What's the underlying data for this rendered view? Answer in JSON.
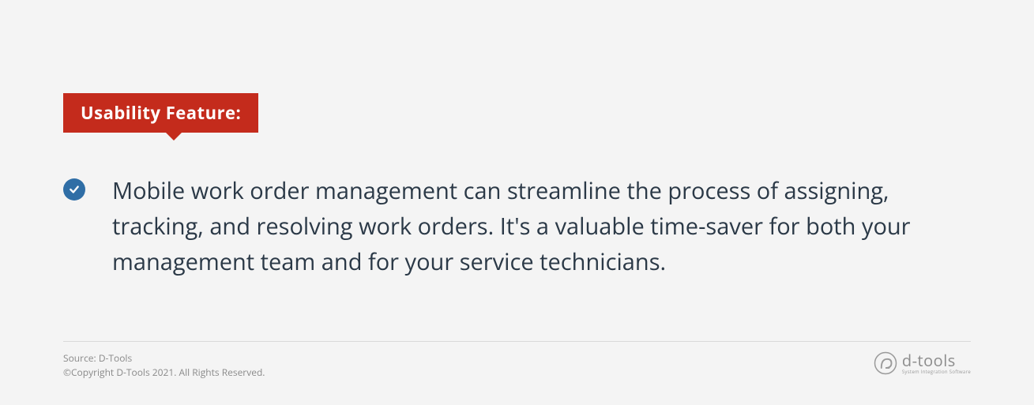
{
  "badge": {
    "label": "Usability Feature:"
  },
  "icon": {
    "name": "check-circle-icon"
  },
  "body": "Mobile work order management can streamline the process of assigning, tracking, and resolving work orders. It's a valuable time-saver for both your management team and for your service technicians.",
  "footer": {
    "source": "Source: D-Tools",
    "copyright": "©Copyright D-Tools 2021. All Rights Reserved."
  },
  "logo": {
    "brand": "d-tools",
    "tagline": "System Integration Software"
  },
  "colors": {
    "badge_bg": "#c42b1c",
    "check_bg": "#2f6ea6",
    "text": "#2b3947",
    "muted": "#8a8a8a"
  }
}
